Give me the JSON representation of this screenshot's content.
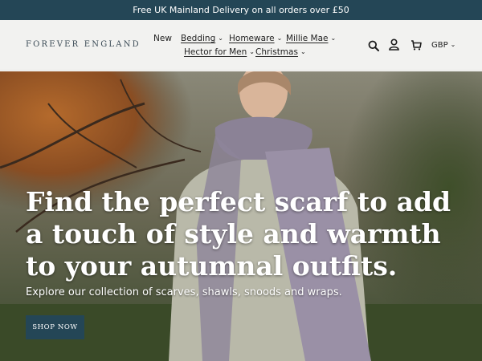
{
  "announcement": {
    "text": "Free UK Mainland Delivery on all orders over £50"
  },
  "header": {
    "logo": "FOREVER ENGLAND",
    "nav": [
      {
        "label": "New",
        "has_dropdown": false
      },
      {
        "label": "Bedding",
        "has_dropdown": true
      },
      {
        "label": "Homeware",
        "has_dropdown": true
      },
      {
        "label": "Millie Mae",
        "has_dropdown": true
      },
      {
        "label": "Hector for Men",
        "has_dropdown": true
      },
      {
        "label": "Christmas",
        "has_dropdown": true
      }
    ],
    "icons": [
      "search-icon",
      "account-icon",
      "cart-icon"
    ],
    "currency": "GBP"
  },
  "hero": {
    "title": "Find the perfect scarf to add a touch of style and warmth to your autumnal outfits.",
    "subtitle": "Explore our collection of scarves, shawls, snoods and wraps.",
    "cta": "SHOP NOW"
  },
  "colors": {
    "brand": "#244656",
    "header_bg": "#f2f2f0"
  }
}
